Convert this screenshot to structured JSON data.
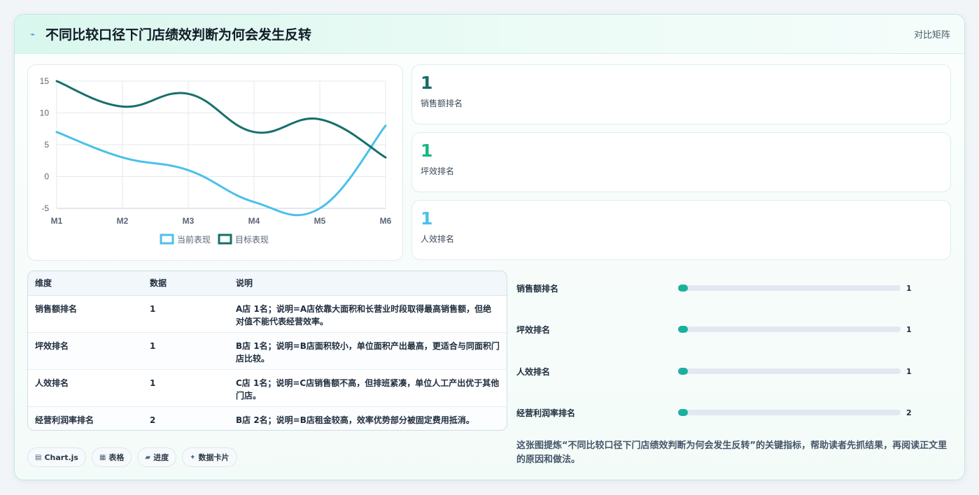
{
  "header": {
    "title": "不同比较口径下门店绩效判断为何会发生反转",
    "right_link": "对比矩阵"
  },
  "chart_data": {
    "type": "line",
    "x": [
      "M1",
      "M2",
      "M3",
      "M4",
      "M5",
      "M6"
    ],
    "series": [
      {
        "name": "当前表现",
        "values": [
          7,
          3,
          1,
          -4,
          -5,
          8
        ],
        "color": "#4cc0ea"
      },
      {
        "name": "目标表现",
        "values": [
          15,
          11,
          13,
          7,
          9,
          3
        ],
        "color": "#15706a"
      }
    ],
    "ylim": [
      -5,
      15
    ],
    "yticks": [
      -5,
      0,
      5,
      10,
      15
    ],
    "grid": true,
    "legend": "bottom"
  },
  "stats": [
    {
      "value": "1",
      "label": "销售额排名",
      "color": "#166b66"
    },
    {
      "value": "1",
      "label": "坪效排名",
      "color": "#18b680"
    },
    {
      "value": "1",
      "label": "人效排名",
      "color": "#4cc0ea"
    }
  ],
  "table": {
    "headers": [
      "维度",
      "数据",
      "说明"
    ],
    "rows": [
      [
        "销售额排名",
        "1",
        "A店 1名；说明=A店依靠大面积和长营业时段取得最高销售额，但绝对值不能代表经营效率。"
      ],
      [
        "坪效排名",
        "1",
        "B店 1名；说明=B店面积较小，单位面积产出最高，更适合与同面积门店比较。"
      ],
      [
        "人效排名",
        "1",
        "C店 1名；说明=C店销售额不高，但排班紧凑，单位人工产出优于其他门店。"
      ],
      [
        "经营利润率排名",
        "2",
        "B店 2名；说明=B店租金较高，效率优势部分被固定费用抵消。"
      ]
    ]
  },
  "progress": [
    {
      "label": "销售额排名",
      "value": "1",
      "fraction": 0.04
    },
    {
      "label": "坪效排名",
      "value": "1",
      "fraction": 0.04
    },
    {
      "label": "人效排名",
      "value": "1",
      "fraction": 0.04
    },
    {
      "label": "经营利润率排名",
      "value": "2",
      "fraction": 0.045
    }
  ],
  "chips": [
    {
      "icon": "chart-icon",
      "glyph": "▤",
      "label": "Chart.js"
    },
    {
      "icon": "table-icon",
      "glyph": "▦",
      "label": "表格"
    },
    {
      "icon": "progress-icon",
      "glyph": "▰",
      "label": "进度"
    },
    {
      "icon": "sparkle-icon",
      "glyph": "✦",
      "label": "数据卡片"
    }
  ],
  "summary": "这张图提炼“不同比较口径下门店绩效判断为何会发生反转”的关键指标，帮助读者先抓结果，再阅读正文里的原因和做法。"
}
